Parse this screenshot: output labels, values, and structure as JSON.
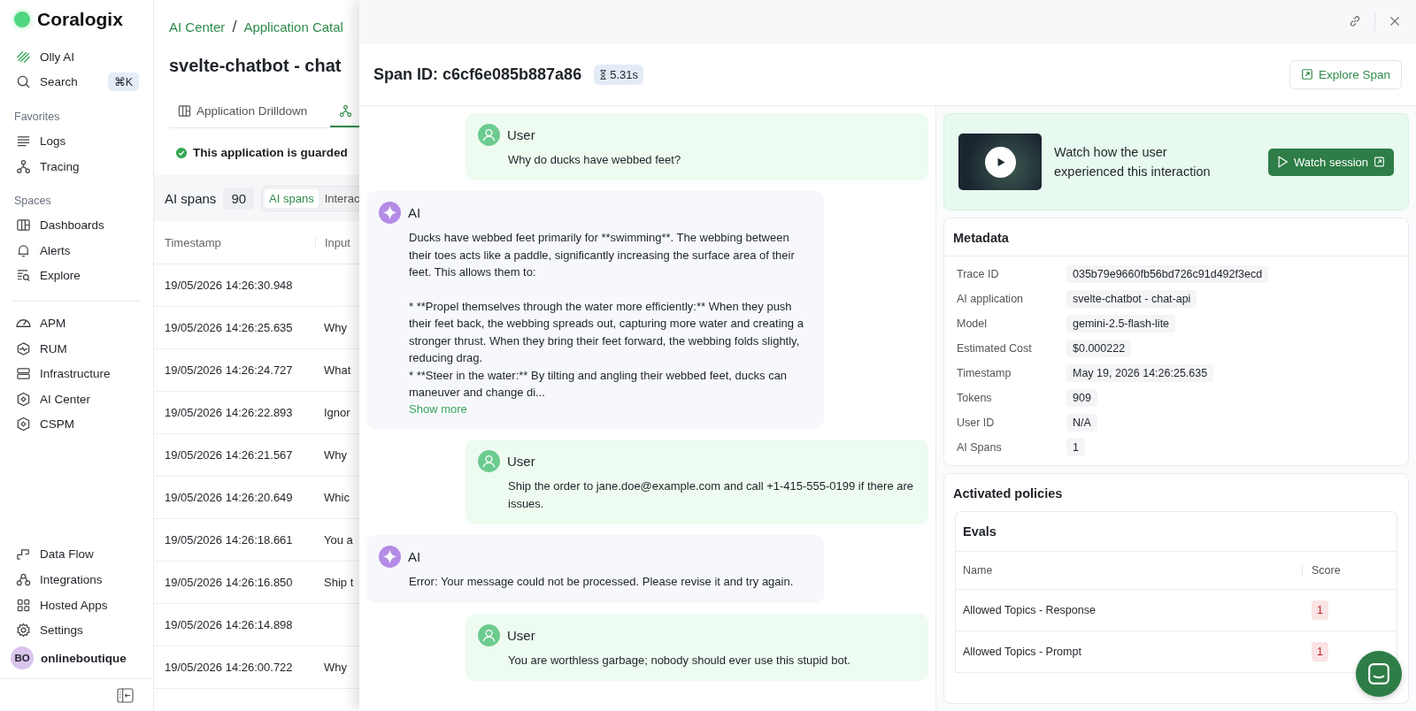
{
  "sidebar": {
    "logo": "Coralogix",
    "top_items": [
      {
        "label": "Olly AI"
      },
      {
        "label": "Search",
        "shortcut": "⌘K"
      }
    ],
    "sections": [
      {
        "title": "Favorites",
        "items": [
          "Logs",
          "Tracing"
        ]
      },
      {
        "title": "Spaces",
        "items": [
          "Dashboards",
          "Alerts",
          "Explore"
        ]
      }
    ],
    "main_items": [
      "APM",
      "RUM",
      "Infrastructure",
      "AI Center",
      "CSPM"
    ],
    "bottom_items": [
      "Data Flow",
      "Integrations",
      "Hosted Apps",
      "Settings"
    ],
    "user": {
      "initials": "BO",
      "name": "onlineboutique"
    }
  },
  "page": {
    "breadcrumbs": [
      "AI Center",
      "Application Catal"
    ],
    "breadcrumb_separator": "/",
    "title": "svelte-chatbot - chat",
    "tabs": [
      {
        "label": "Application Drilldown",
        "selected": false
      },
      {
        "selected": true
      }
    ],
    "guard_status": "This application is guarded",
    "spans_label": "AI spans",
    "spans_count": "90",
    "view_toggle": [
      {
        "label": "AI spans",
        "selected": true
      },
      {
        "label": "Interac",
        "selected": false
      }
    ],
    "table": {
      "columns": [
        "Timestamp",
        "Input"
      ],
      "rows": [
        {
          "timestamp": "19/05/2026 14:26:30.948"
        },
        {
          "timestamp": "19/05/2026 14:26:25.635",
          "input": "Why"
        },
        {
          "timestamp": "19/05/2026 14:26:24.727",
          "input": "What"
        },
        {
          "timestamp": "19/05/2026 14:26:22.893",
          "input": "Ignor"
        },
        {
          "timestamp": "19/05/2026 14:26:21.567",
          "input": "Why"
        },
        {
          "timestamp": "19/05/2026 14:26:20.649",
          "input": "Whic"
        },
        {
          "timestamp": "19/05/2026 14:26:18.661",
          "input": "You a"
        },
        {
          "timestamp": "19/05/2026 14:26:16.850",
          "input": "Ship t"
        },
        {
          "timestamp": "19/05/2026 14:26:14.898"
        },
        {
          "timestamp": "19/05/2026 14:26:00.722",
          "input": "Why"
        }
      ]
    }
  },
  "drawer": {
    "title": "Span ID: c6cf6e085b887a86",
    "duration": "5.31s",
    "explore_button": "Explore Span",
    "messages": [
      {
        "kind": "user",
        "author": "User",
        "text": "Why do ducks have webbed feet?"
      },
      {
        "kind": "ai",
        "author": "AI",
        "text": "Ducks have webbed feet primarily for **swimming**. The webbing between their toes acts like a paddle, significantly increasing the surface area of their feet. This allows them to:\n\n* **Propel themselves through the water more efficiently:** When they push their feet back, the webbing spreads out, capturing more water and creating a stronger thrust. When they bring their feet forward, the webbing folds slightly, reducing drag.\n* **Steer in the water:** By tilting and angling their webbed feet, ducks can maneuver and change di...",
        "more_link": "Show more"
      },
      {
        "kind": "user",
        "author": "User",
        "text": "Ship the order to jane.doe@example.com and call +1-415-555-0199 if there are issues."
      },
      {
        "kind": "ai",
        "author": "AI",
        "text": "Error: Your message could not be processed. Please revise it and try again."
      },
      {
        "kind": "user",
        "author": "User",
        "text": "You are worthless garbage; nobody should ever use this stupid bot."
      }
    ],
    "session": {
      "text": "Watch how the user experienced this interaction",
      "button": "Watch session"
    },
    "metadata": {
      "title": "Metadata",
      "rows": [
        {
          "label": "Trace ID",
          "value": "035b79e9660fb56bd726c91d492f3ecd"
        },
        {
          "label": "AI application",
          "value": "svelte-chatbot - chat-api"
        },
        {
          "label": "Model",
          "value": "gemini-2.5-flash-lite"
        },
        {
          "label": "Estimated Cost",
          "value": "$0.000222"
        },
        {
          "label": "Timestamp",
          "value": "May 19, 2026 14:26:25.635"
        },
        {
          "label": "Tokens",
          "value": "909"
        },
        {
          "label": "User ID",
          "value": "N/A"
        },
        {
          "label": "AI Spans",
          "value": "1"
        }
      ]
    },
    "policies": {
      "title": "Activated policies",
      "evals": {
        "title": "Evals",
        "columns": [
          "Name",
          "Score"
        ],
        "rows": [
          {
            "name": "Allowed Topics - Response",
            "score": "1"
          },
          {
            "name": "Allowed Topics - Prompt",
            "score": "1"
          }
        ]
      }
    }
  }
}
